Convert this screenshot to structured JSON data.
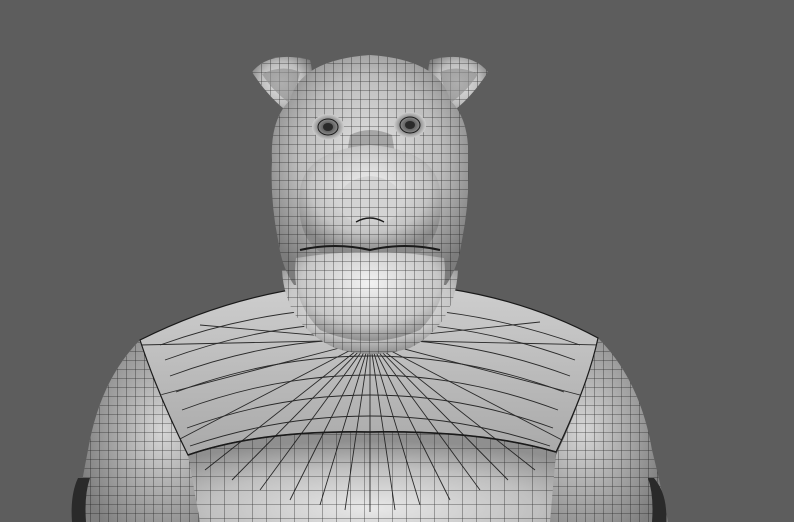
{
  "viewport": {
    "background": "#5d5d5d",
    "shading": "smooth-shaded-with-wireframe",
    "subject": "character-mesh"
  },
  "mesh": {
    "surface_light": "#e6e6e6",
    "surface_mid": "#b4b4b4",
    "surface_dark": "#6a6a6a",
    "wire_color": "#1a1a1a"
  }
}
